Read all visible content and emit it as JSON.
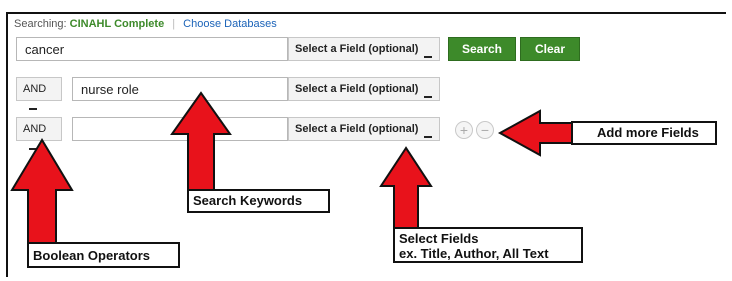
{
  "header": {
    "searching_prefix": "Searching:",
    "database": "CINAHL Complete",
    "choose_databases": "Choose Databases"
  },
  "rows": [
    {
      "keyword": "cancer",
      "field": "Select a Field (optional)"
    },
    {
      "operator": "AND",
      "keyword": "nurse role",
      "field": "Select a Field (optional)"
    },
    {
      "operator": "AND",
      "keyword": "",
      "field": "Select a Field (optional)"
    }
  ],
  "buttons": {
    "search": "Search",
    "clear": "Clear",
    "add": "+",
    "remove": "−"
  },
  "annotations": {
    "add_more": "Add more Fields",
    "search_keywords": "Search Keywords",
    "boolean_operators": "Boolean Operators",
    "select_fields_line1": "Select Fields",
    "select_fields_line2": "ex. Title, Author, All Text"
  },
  "colors": {
    "accent_green": "#3d8a2a",
    "arrow_red": "#e8121b",
    "link_blue": "#1b63b8"
  }
}
